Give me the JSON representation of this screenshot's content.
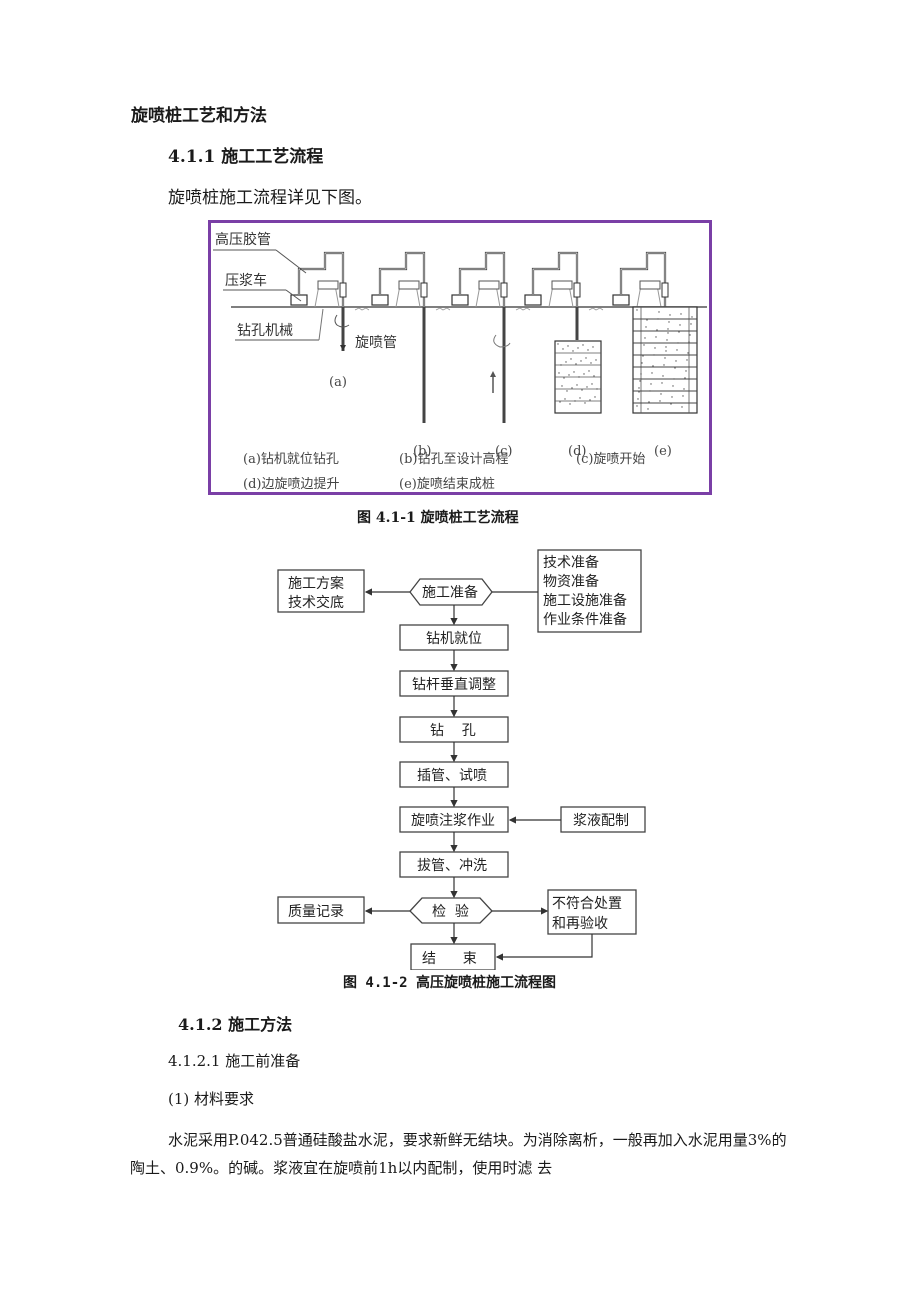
{
  "document": {
    "title": "旋喷桩工艺和方法",
    "section_1": {
      "heading": "4.1.1  施工工艺流程",
      "intro": "旋喷桩施工流程详见下图。"
    },
    "figure_1": {
      "labels": {
        "high_pressure_hose": "高压胶管",
        "grout_truck": "压浆车",
        "drilling_machine": "钻孔机械",
        "jet_pipe": "旋喷管"
      },
      "stage_markers": [
        "(a)",
        "(b)",
        "(c)",
        "(d)",
        "(e)"
      ],
      "legend": [
        "(a)钻机就位钻孔",
        "(b)钻孔至设计高程",
        "(c)旋喷开始",
        "(d)边旋喷边提升",
        "(e)旋喷结束成桩"
      ],
      "caption": "图 4.1-1   旋喷桩工艺流程",
      "border_color": "#7a3fa6"
    },
    "figure_2": {
      "nodes": {
        "prep": "施工准备",
        "plan_line1": "施工方案",
        "plan_line2": "技术交底",
        "prep_list": [
          "技术准备",
          "物资准备",
          "施工设施准备",
          "作业条件准备"
        ],
        "rig_position": "钻机就位",
        "rod_adjust": "钻杆垂直调整",
        "drill": "钻    孔",
        "insert_test": "插管、试喷",
        "jet_grout": "旋喷注浆作业",
        "slurry_mix": "浆液配制",
        "pull_flush": "拔管、冲洗",
        "inspect": "检  验",
        "quality_record": "质量记录",
        "nonconform_line1": "不符合处置",
        "nonconform_line2": "和再验收",
        "end": "结      束"
      },
      "caption": "图 4.1-2 高压旋喷桩施工流程图"
    },
    "section_2": {
      "heading": "4.1.2  施工方法",
      "subheading": "4.1.2.1 施工前准备",
      "item": "(1)  材料要求",
      "paragraph": "水泥采用P.042.5普通硅酸盐水泥，要求新鲜无结块。为消除离析，一般再加入水泥用量3%的陶土、0.9%。的碱。浆液宜在旋喷前1h以内配制，使用时滤 去"
    }
  }
}
